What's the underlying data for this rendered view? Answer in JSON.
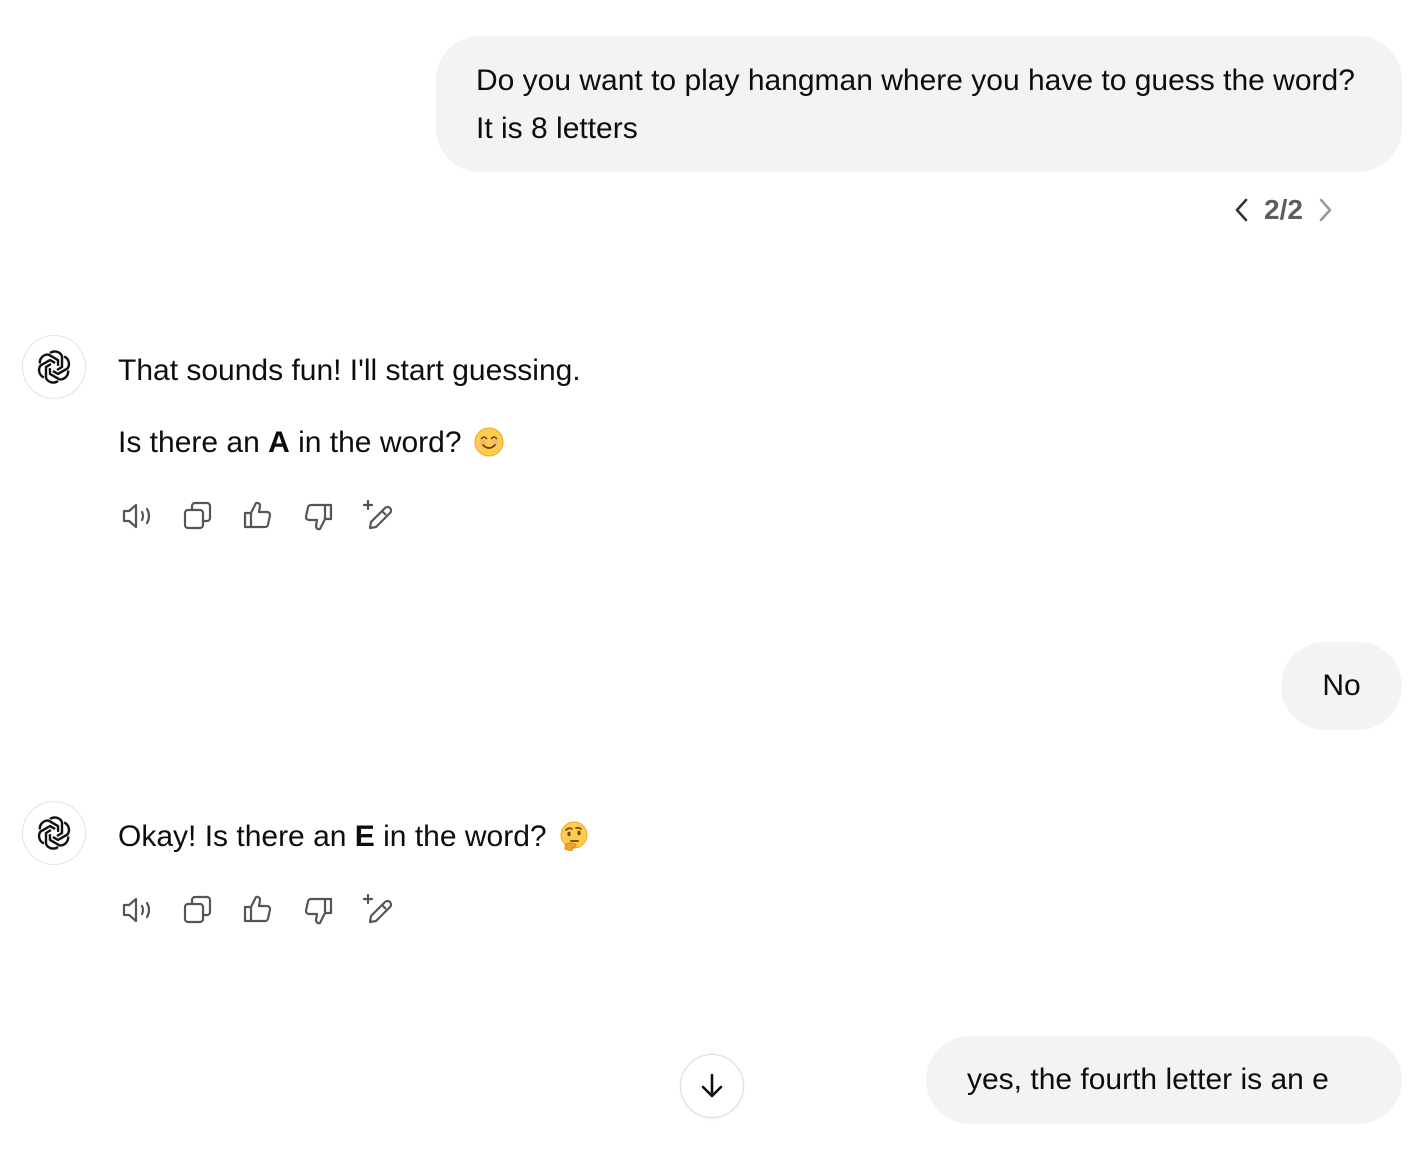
{
  "messages": [
    {
      "role": "user",
      "text": "Do you want to play hangman where you have to guess the word? It is 8 letters"
    },
    {
      "role": "assistant",
      "lines": [
        {
          "parts": [
            "That sounds fun! I'll start guessing."
          ]
        },
        {
          "parts": [
            "Is there an ",
            "A",
            " in the word?"
          ],
          "emoji": "smiling-face-icon"
        }
      ]
    },
    {
      "role": "user",
      "text": "No"
    },
    {
      "role": "assistant",
      "lines": [
        {
          "parts": [
            "Okay! Is there an ",
            "E",
            " in the word?"
          ],
          "emoji": "thinking-face-icon"
        }
      ]
    },
    {
      "role": "user",
      "text": "yes, the fourth letter is an e"
    }
  ],
  "pager": {
    "label": "2/2"
  },
  "actions": [
    "read-aloud-icon",
    "copy-icon",
    "thumbs-up-icon",
    "thumbs-down-icon",
    "edit-sparkle-icon"
  ],
  "colors": {
    "user_bubble": "#f3f3f3",
    "text": "#0d0d0d",
    "muted": "#5d5d5d"
  }
}
